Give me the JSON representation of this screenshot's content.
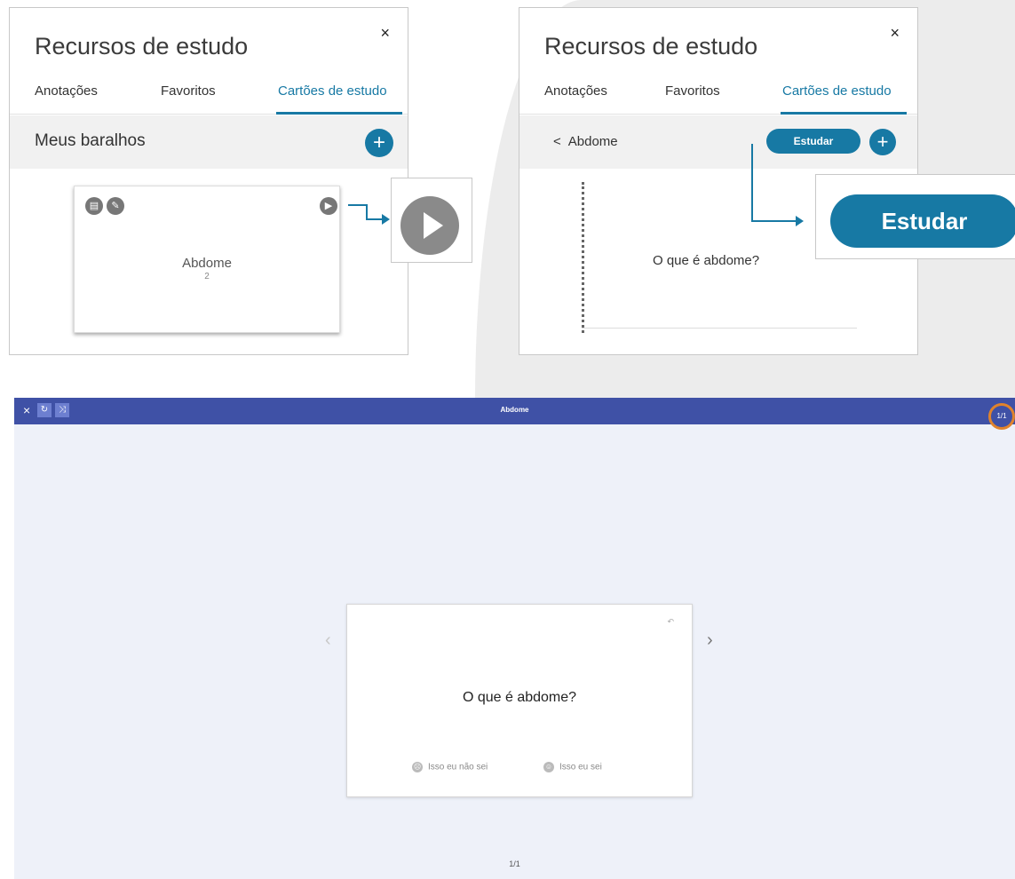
{
  "left_panel": {
    "title": "Recursos de estudo",
    "close_icon": "×",
    "tabs": [
      "Anotações",
      "Favoritos",
      "Cartões de estudo"
    ],
    "section_title": "Meus baralhos",
    "add_icon": "+",
    "deck": {
      "name": "Abdome",
      "count": "2",
      "icons": [
        "document-icon",
        "pencil-icon",
        "play-icon"
      ]
    }
  },
  "play_callout": {
    "icon": "play-icon"
  },
  "right_panel": {
    "title": "Recursos de estudo",
    "close_icon": "×",
    "tabs": [
      "Anotações",
      "Favoritos",
      "Cartões de estudo"
    ],
    "back_label": "Abdome",
    "back_icon": "<",
    "study_label": "Estudar",
    "add_icon": "+",
    "card_question": "O que é abdome?"
  },
  "estudar_callout": {
    "label": "Estudar"
  },
  "viewer": {
    "close_icon": "×",
    "title": "Abdome",
    "counter": "1/1",
    "question": "O que é abdome?",
    "prev_icon": "‹",
    "next_icon": "›",
    "dont_know": "Isso eu não sei",
    "know": "Isso eu sei",
    "page": "1/1"
  },
  "colors": {
    "accent": "#1779a4",
    "topbar": "#3f51a6",
    "highlight": "#e0832c"
  }
}
